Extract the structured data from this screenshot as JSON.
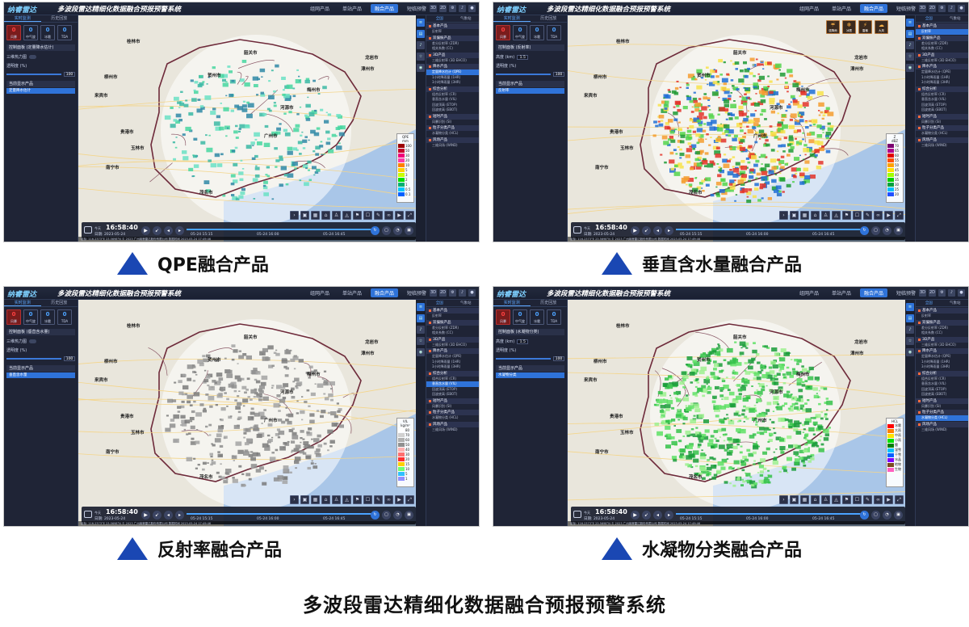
{
  "app": {
    "logo": "纳睿雷达",
    "title": "多波段雷达精细化数据融合预报预警系统",
    "nav": [
      "组网产品",
      "单站产品",
      "融合产品",
      "短临预警"
    ],
    "active_nav": "融合产品",
    "mode_labels": [
      "2D",
      "3D"
    ]
  },
  "left_tabs": [
    "实时监测",
    "历史回放"
  ],
  "alerts": [
    {
      "num": "0",
      "label": "风暴"
    },
    {
      "num": "0",
      "label": "中气旋"
    },
    {
      "num": "0",
      "label": "冰雹"
    },
    {
      "num": "0",
      "label": "TDA"
    }
  ],
  "right_tabs": [
    "全国",
    "气象站"
  ],
  "right_categories": [
    {
      "name": "基本产品",
      "items": [
        "反射率"
      ]
    },
    {
      "name": "双偏振产品",
      "items": [
        "差分反射率 (ZDR)",
        "相关系数 (CC)"
      ]
    },
    {
      "name": "3D产品",
      "items": [
        "三维反射率 (3D EHCO)"
      ]
    },
    {
      "name": "降水产品",
      "items": [
        "定量降水估计 (QPE)",
        "1小时降雨量 (1HR)",
        "3小时降雨量 (3HR)"
      ]
    },
    {
      "name": "综合分析",
      "items": [
        "组合反射率 (CR)",
        "垂直含水量 (VIL)",
        "回波顶高 (ETOP)",
        "回波底高 (EBOT)"
      ]
    },
    {
      "name": "短时产品",
      "items": [
        "风暴识别 (SI)"
      ]
    },
    {
      "name": "粒子分类产品",
      "items": [
        "水凝物分类 (HCL)"
      ]
    },
    {
      "name": "风场产品",
      "items": [
        "三维风场 (WIND)"
      ]
    }
  ],
  "cities": [
    "桂林市",
    "韶关市",
    "龙岩市",
    "漳州市",
    "柳州市",
    "来宾市",
    "河源市",
    "梅州市",
    "贺州市",
    "贵港市",
    "玉林市",
    "茂名市",
    "南宁市",
    "广州市"
  ],
  "player": {
    "today_label": "今天",
    "time": "16:58:40",
    "date": "日期: 2023-05-24",
    "ticks": [
      "05-24 15:15",
      "05-24 16:00",
      "05-24 16:45"
    ]
  },
  "status_text": "坐标: 116.2373°E  23.5698°N   © 2023 广州纳睿雷达股份有限公司   数据时间 2023-05-24 17:49:46",
  "legend_title_mm": "mm",
  "panels": [
    {
      "caption": "QPE融合产品",
      "control_title": "控制面板 (定量降水估计)",
      "current_product": "当前显示产品",
      "selected_product": "定量降水估计",
      "selected_right": "定量降水估计 (QPE)",
      "legend": {
        "title": "QPE",
        "unit": "mm",
        "labels": [
          "100",
          "50",
          "30",
          "20",
          "10",
          "5",
          "3",
          "2",
          "1",
          "0.5",
          "0.1"
        ]
      },
      "rows": [
        "三维热力图",
        "透明度 (%)"
      ],
      "opacity": "100"
    },
    {
      "caption": "垂直含水量融合产品",
      "control_title": "控制面板 (反射率)",
      "current_product": "当前显示产品",
      "selected_product": "反射率",
      "selected_right": "反射率",
      "legend": {
        "title": "Z",
        "unit": "dBZ",
        "labels": [
          "70",
          "65",
          "60",
          "55",
          "50",
          "45",
          "40",
          "35",
          "30",
          "25",
          "20"
        ]
      },
      "rows": [
        "高度 (km)",
        "透明度 (%)"
      ],
      "height_value": "1.5",
      "opacity": "100",
      "quick": [
        {
          "g": "☔",
          "l": "强降雨"
        },
        {
          "g": "❄",
          "l": "冰雹"
        },
        {
          "g": "⚡",
          "l": "雷暴"
        },
        {
          "g": "☁",
          "l": "大风"
        }
      ]
    },
    {
      "caption": "反射率融合产品",
      "control_title": "控制面板 (垂直含水量)",
      "current_product": "当前显示产品",
      "selected_product": "垂直含水量",
      "selected_right": "垂直含水量 (VIL)",
      "legend": {
        "title": "VIL",
        "unit": "kg/m²",
        "labels": [
          "80",
          "70",
          "60",
          "50",
          "40",
          "30",
          "20",
          "15",
          "10",
          "5",
          "1"
        ]
      },
      "rows": [
        "三维热力图",
        "透明度 (%)"
      ],
      "opacity": "100"
    },
    {
      "caption": "水凝物分类融合产品",
      "control_title": "控制面板 (水凝物分类)",
      "current_product": "当前显示产品",
      "selected_product": "水凝物分类",
      "selected_right": "水凝物分类 (HCL)",
      "legend": {
        "title": "HCL",
        "unit": "",
        "labels": [
          "冰雹",
          "大雨",
          "中雨",
          "小雨",
          "霰",
          "湿雪",
          "干雪",
          "冰晶",
          "地物",
          "生物"
        ]
      },
      "rows": [
        "高度 (km)",
        "透明度 (%)"
      ],
      "height_value": "1.5",
      "opacity": "100"
    }
  ],
  "footer_title": "多波段雷达精细化数据融合预报预警系统",
  "colors": {
    "qpe": [
      "#2f88a6",
      "#3bb8a4",
      "#46d6a0",
      "#6ae1c4"
    ],
    "refl": [
      "#1e9a35",
      "#53d44c",
      "#f7e24a",
      "#f49c2f",
      "#e3342a",
      "#1f6fd6"
    ],
    "vil": [
      "#7b7b7b",
      "#8e8e8e",
      "#a3a3a3"
    ],
    "hcl": [
      "#1a9c3a",
      "#35c24a",
      "#5ee065",
      "#9ef08f"
    ],
    "accent": "#2f73d9",
    "caption_triangle": "#1a47b3"
  }
}
